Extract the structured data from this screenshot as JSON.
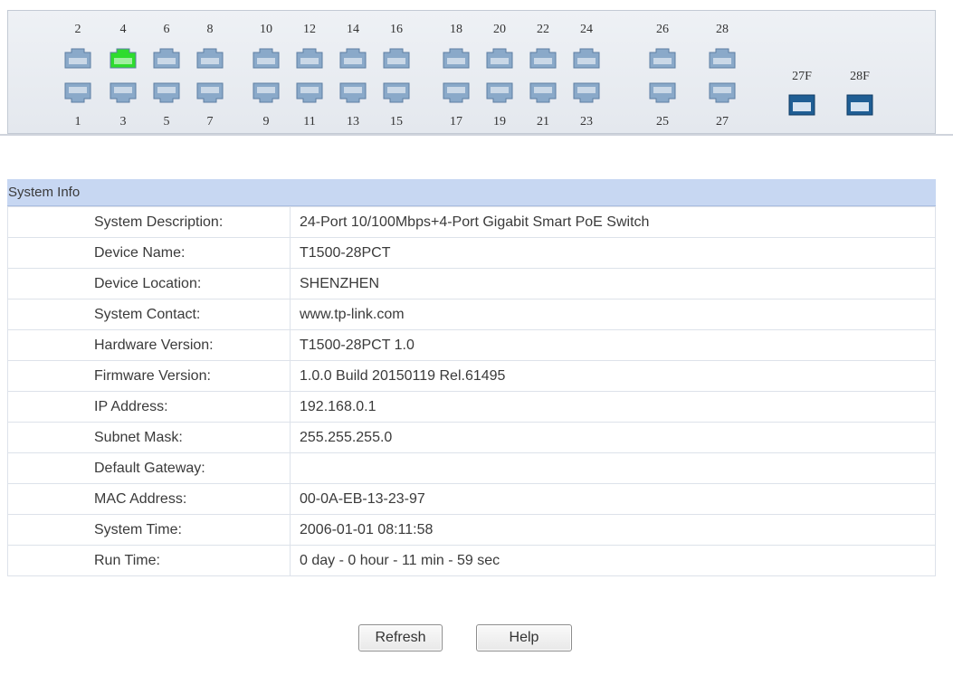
{
  "panel": {
    "ports_top": [
      {
        "label": "2",
        "state": "down"
      },
      {
        "label": "4",
        "state": "up"
      },
      {
        "label": "6",
        "state": "down"
      },
      {
        "label": "8",
        "state": "down"
      },
      {
        "label": "10",
        "state": "down"
      },
      {
        "label": "12",
        "state": "down"
      },
      {
        "label": "14",
        "state": "down"
      },
      {
        "label": "16",
        "state": "down"
      },
      {
        "label": "18",
        "state": "down"
      },
      {
        "label": "20",
        "state": "down"
      },
      {
        "label": "22",
        "state": "down"
      },
      {
        "label": "24",
        "state": "down"
      },
      {
        "label": "26",
        "state": "down"
      },
      {
        "label": "28",
        "state": "down"
      }
    ],
    "ports_bottom": [
      {
        "label": "1",
        "state": "down"
      },
      {
        "label": "3",
        "state": "down"
      },
      {
        "label": "5",
        "state": "down"
      },
      {
        "label": "7",
        "state": "down"
      },
      {
        "label": "9",
        "state": "down"
      },
      {
        "label": "11",
        "state": "down"
      },
      {
        "label": "13",
        "state": "down"
      },
      {
        "label": "15",
        "state": "down"
      },
      {
        "label": "17",
        "state": "down"
      },
      {
        "label": "19",
        "state": "down"
      },
      {
        "label": "21",
        "state": "down"
      },
      {
        "label": "23",
        "state": "down"
      },
      {
        "label": "25",
        "state": "down"
      },
      {
        "label": "27",
        "state": "down"
      }
    ],
    "sfp_ports": [
      {
        "label": "27F"
      },
      {
        "label": "28F"
      }
    ],
    "colors": {
      "port_down": "#8aa9c9",
      "port_up": "#2edc2e",
      "sfp": "#1f5e94"
    }
  },
  "system_info": {
    "title": "System Info",
    "rows": [
      {
        "label": "System Description:",
        "value": "24-Port 10/100Mbps+4-Port Gigabit Smart PoE Switch"
      },
      {
        "label": "Device Name:",
        "value": "T1500-28PCT"
      },
      {
        "label": "Device Location:",
        "value": "SHENZHEN"
      },
      {
        "label": "System Contact:",
        "value": "www.tp-link.com"
      },
      {
        "label": "Hardware Version:",
        "value": "T1500-28PCT 1.0"
      },
      {
        "label": "Firmware Version:",
        "value": "1.0.0 Build 20150119 Rel.61495"
      },
      {
        "label": "IP Address:",
        "value": "192.168.0.1"
      },
      {
        "label": "Subnet Mask:",
        "value": "255.255.255.0"
      },
      {
        "label": "Default Gateway:",
        "value": ""
      },
      {
        "label": "MAC Address:",
        "value": "00-0A-EB-13-23-97"
      },
      {
        "label": "System Time:",
        "value": "2006-01-01 08:11:58"
      },
      {
        "label": "Run Time:",
        "value": "0 day - 0 hour - 11 min - 59 sec"
      }
    ]
  },
  "buttons": {
    "refresh": "Refresh",
    "help": "Help"
  }
}
